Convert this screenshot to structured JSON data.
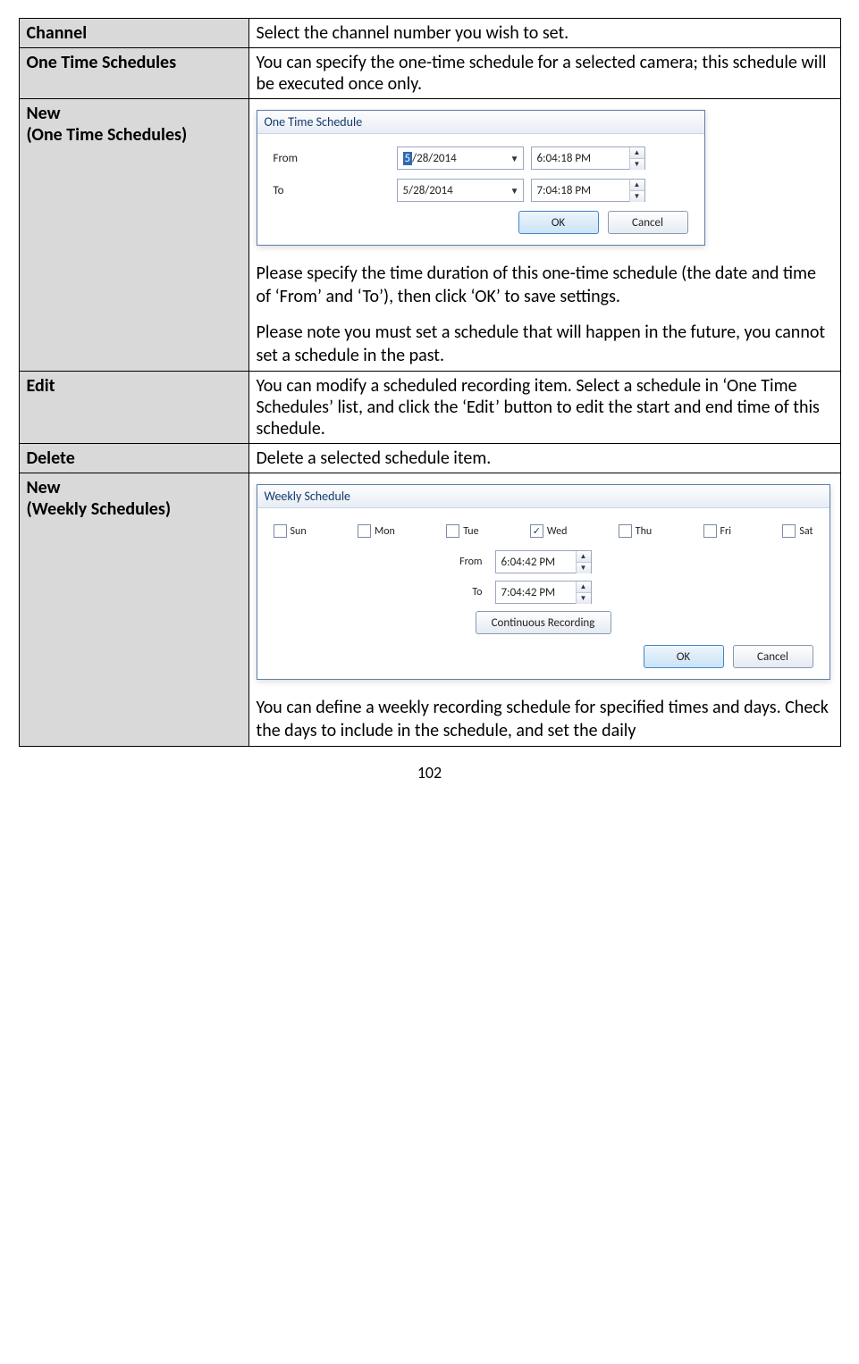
{
  "rows": {
    "channel": {
      "label": "Channel",
      "desc": "Select the channel number you wish to set."
    },
    "one_time_schedules": {
      "label": "One Time Schedules",
      "desc": "You can specify the one-time schedule for a selected camera; this schedule will be executed once only."
    },
    "new_one_time": {
      "label_line1": "New",
      "label_line2": "(One Time Schedules)",
      "para1": "Please specify the time duration of this one-time schedule (the date and time of ‘From’ and ‘To’), then click ‘OK’ to save settings.",
      "para2": "Please note you must set a schedule that will happen in the future, you cannot set a schedule in the past."
    },
    "edit": {
      "label": "Edit",
      "desc": "You can modify a scheduled recording item. Select a schedule in ‘One Time Schedules’ list, and click the ‘Edit’ button to edit the start and end time of this schedule."
    },
    "delete": {
      "label": "Delete",
      "desc": "Delete a selected schedule item."
    },
    "new_weekly": {
      "label_line1": "New",
      "label_line2": "(Weekly Schedules)",
      "para1": "You can define a weekly recording schedule for specified times and days. Check the days to include in the schedule, and set the daily"
    }
  },
  "onetime_dialog": {
    "title": "One Time Schedule",
    "from_label": "From",
    "to_label": "To",
    "from_date_sel": "5",
    "from_date_rest": "/28/2014",
    "from_time": "6:04:18 PM",
    "to_date": "5/28/2014",
    "to_time": "7:04:18 PM",
    "ok": "OK",
    "cancel": "Cancel"
  },
  "weekly_dialog": {
    "title": "Weekly Schedule",
    "days": [
      {
        "label": "Sun",
        "checked": false
      },
      {
        "label": "Mon",
        "checked": false
      },
      {
        "label": "Tue",
        "checked": false
      },
      {
        "label": "Wed",
        "checked": true
      },
      {
        "label": "Thu",
        "checked": false
      },
      {
        "label": "Fri",
        "checked": false
      },
      {
        "label": "Sat",
        "checked": false
      }
    ],
    "from_label": "From",
    "to_label": "To",
    "from_time": "6:04:42 PM",
    "to_time": "7:04:42 PM",
    "continuous": "Continuous Recording",
    "ok": "OK",
    "cancel": "Cancel"
  },
  "page_number": "102"
}
